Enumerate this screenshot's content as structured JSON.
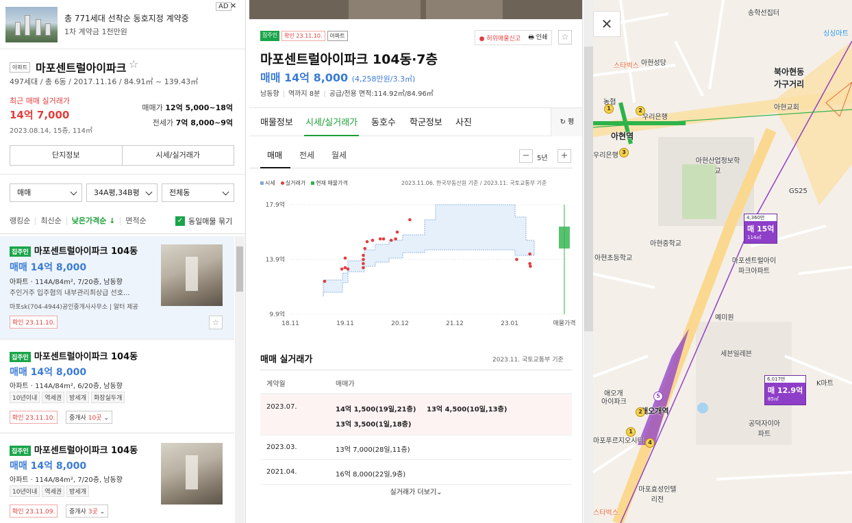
{
  "ad": {
    "title": "총 771세대 선착순 동호지정 계약중",
    "subtitle": "1차 계약금 1천만원",
    "badge": "AD",
    "close": "✕"
  },
  "complex": {
    "tag": "아파트",
    "name": "마포센트럴아이파크",
    "star": "☆",
    "info": "497세대 / 총 6동 / 2017.11.16 / 84.91㎡ ~ 139.43㎡",
    "recent_label": "최근 매매 실거래가",
    "recent_price": "14억 7,000",
    "recent_date": "2023.08.14, 15층, 114㎡",
    "sale_range_label": "매매가",
    "sale_range": "12억 5,000~18억",
    "jeonse_range_label": "전세가",
    "jeonse_range": "7억 8,000~9억",
    "btn_info": "단지정보",
    "btn_price": "시세/실거래가"
  },
  "filters": {
    "trade": "매매",
    "area": "34A평,34B평",
    "dong": "전체동"
  },
  "sorts": {
    "items": [
      "랭킹순",
      "최신순",
      "낮은가격순 ↓",
      "면적순"
    ],
    "same_listing": "동일매물 묶기",
    "check": "✓"
  },
  "listings": [
    {
      "tag": "집주인",
      "title": "마포센트럴아이파크 104동",
      "price": "매매 14억 8,000",
      "spec": "아파트 · 114A/84m², 7/20층, 남동향",
      "desc": "주인거주 입주협의 내부관리최상급 선호...",
      "agent": "마포sk(704-4944)공인중개사사무소 | 알터 제공",
      "confirm": "확인 23.11.10.",
      "fav": "☆"
    },
    {
      "tag": "집주인",
      "title": "마포센트럴아이파크 104동",
      "price": "매매 14억 8,000",
      "spec": "아파트 · 114A/84m², 6/20층, 남동향",
      "chips": [
        "10년이내",
        "역세권",
        "방세개",
        "화장실두개"
      ],
      "confirm": "확인 23.11.10.",
      "broker_label": "중개사",
      "broker_count": "10곳"
    },
    {
      "tag": "집주인",
      "title": "마포센트럴아이파크 104동",
      "price": "매매 14억 8,000",
      "spec": "아파트 · 114A/84m², 7/20층, 남동향",
      "chips": [
        "10년이내",
        "역세권",
        "방세개"
      ],
      "confirm": "확인 23.11.09.",
      "broker_label": "중개사",
      "broker_count": "3곳"
    }
  ],
  "detail": {
    "tag_owner": "집주인",
    "tag_confirm": "확인 23.11.10.",
    "tag_type": "아파트",
    "report": "허위매물신고",
    "print": "인쇄",
    "fav": "☆",
    "title": "마포센트럴아이파크 104동·7층",
    "price": "매매 14억 8,000",
    "price_per": "(4,258만원/3.3㎡)",
    "spec": [
      "남동향",
      "역까지 8분",
      "공급/전용 면적:114.92㎡/84.96㎡"
    ],
    "tabs": [
      "매물정보",
      "시세/실거래가",
      "동호수",
      "학군정보",
      "사진"
    ],
    "pyeong": "↻ 평",
    "sub_tabs": [
      "매매",
      "전세",
      "월세"
    ],
    "years": "5년",
    "minus": "−",
    "plus": "+",
    "legend": [
      "시세",
      "실거래가",
      "현재 매물가격"
    ],
    "source": "2023.11.06. 한국부동산원 기준 / 2023.11. 국토교통부 기준",
    "rt_title": "매매 실거래가",
    "rt_source": "2023.11. 국토교통부 기준",
    "rt_head": [
      "계약월",
      "매매가"
    ],
    "rt_rows": [
      {
        "month": "2023.07.",
        "v1": "14억 1,500(19일,21층)",
        "v2": "13억 4,500(10일,13층)",
        "v3": "13억 3,500(1일,18층)"
      },
      {
        "month": "2023.03.",
        "v1": "13억 7,000(28일,11층)"
      },
      {
        "month": "2021.04.",
        "v1": "16억 8,000(22일,9층)"
      }
    ],
    "more": "실거래가 더보기⌄"
  },
  "chart_data": {
    "type": "line",
    "y_tick_labels": [
      "17.9억",
      "13.9억",
      "9.9억"
    ],
    "x_tick_labels": [
      "18.11",
      "19.11",
      "20.12",
      "21.12",
      "23.01",
      "매물가격"
    ],
    "ylim": [
      9.9,
      17.9
    ],
    "series": [
      {
        "name": "시세",
        "kind": "band"
      },
      {
        "name": "실거래가",
        "kind": "points",
        "values": [
          [
            0.625,
            12.3
          ],
          [
            0.94,
            13.2
          ],
          [
            1.0,
            13.3
          ],
          [
            1.05,
            13.2
          ],
          [
            1.0,
            14.0
          ],
          [
            1.33,
            13.3
          ],
          [
            1.33,
            13.6
          ],
          [
            1.33,
            13.9
          ],
          [
            1.33,
            14.2
          ],
          [
            1.36,
            14.7
          ],
          [
            1.4,
            15.2
          ],
          [
            1.5,
            15.3
          ],
          [
            1.64,
            15.4
          ],
          [
            1.7,
            15.4
          ],
          [
            1.84,
            15.3
          ],
          [
            1.92,
            15.4
          ],
          [
            1.95,
            15.9
          ],
          [
            2.18,
            16.8
          ],
          [
            4.13,
            13.9
          ],
          [
            4.37,
            14.3
          ],
          [
            4.37,
            13.6
          ],
          [
            4.38,
            13.4
          ]
        ]
      },
      {
        "name": "현재 매물가격",
        "kind": "bar",
        "range": [
          14.7,
          16.3
        ]
      }
    ]
  },
  "map": {
    "close": "✕",
    "labels": [
      "송학선집터",
      "아현성당",
      "북아현동",
      "가구거리",
      "스타벅스",
      "농협",
      "우리은행",
      "아현교회",
      "아현역",
      "우리은행",
      "아현산업정보학교",
      "GS25",
      "아현중학교",
      "아현초등학교",
      "마포센트럴아이파크아파트",
      "애오개",
      "아이파크",
      "예미원",
      "세븐일레븐",
      "애오개역",
      "공덕자이아파트",
      "K마트",
      "마포효성인텔리전",
      "마포푸르지오시티",
      "스타벅스",
      "싱싱마트"
    ],
    "markers": [
      {
        "top": "4,360만",
        "price": "매 15억",
        "area": "114㎡"
      },
      {
        "top": "6,017만",
        "price": "매 12.9억",
        "area": "85㎡"
      }
    ]
  }
}
